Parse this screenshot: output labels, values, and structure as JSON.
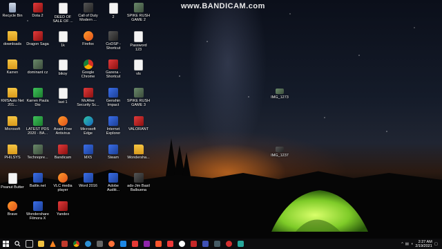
{
  "watermark": "www.BANDICAM.com",
  "desktop_icons": [
    {
      "label": "Recycle Bin",
      "type": "bin"
    },
    {
      "label": "Dota 2",
      "type": "red"
    },
    {
      "label": "DEED OF SALE OF ...",
      "type": "file"
    },
    {
      "label": "Call of Duty Modern ...",
      "type": "dark"
    },
    {
      "label": "2",
      "type": "file"
    },
    {
      "label": "SPIKE RUSH GAME 2",
      "type": "photo"
    },
    {
      "label": "downloads",
      "type": "folder"
    },
    {
      "label": "Dragon Saga",
      "type": "red"
    },
    {
      "label": "1k",
      "type": "file"
    },
    {
      "label": "Firefox",
      "type": "orange"
    },
    {
      "label": "CoDSP - Shortcut",
      "type": "dark"
    },
    {
      "label": "Password 123",
      "type": "file"
    },
    {
      "label": "Karren",
      "type": "folder"
    },
    {
      "label": "dominant cz",
      "type": "photo"
    },
    {
      "label": "bikoy",
      "type": "file"
    },
    {
      "label": "Google Chrome",
      "type": "chrome"
    },
    {
      "label": "Garena - Shortcut",
      "type": "red"
    },
    {
      "label": "vls",
      "type": "file"
    },
    {
      "label": "KMSAuto Net 201...",
      "type": "folder"
    },
    {
      "label": "Karren Paula Dio",
      "type": "green"
    },
    {
      "label": "last 1",
      "type": "file"
    },
    {
      "label": "McAfee Security Sc...",
      "type": "red"
    },
    {
      "label": "Genshin Impact",
      "type": "app"
    },
    {
      "label": "SPIKE RUSH GAME 3",
      "type": "photo"
    },
    {
      "label": "Microsoft",
      "type": "folder"
    },
    {
      "label": "LATEST PDS 2020 - BA...",
      "type": "green"
    },
    {
      "label": "Avast Free Antivirus",
      "type": "orange"
    },
    {
      "label": "Microsoft Edge",
      "type": "edge"
    },
    {
      "label": "Internet Explorer",
      "type": "app"
    },
    {
      "label": "VALORANT",
      "type": "red"
    },
    {
      "label": "PHILSYS",
      "type": "folder"
    },
    {
      "label": "Technopre...",
      "type": "photo"
    },
    {
      "label": "Bandicam",
      "type": "red"
    },
    {
      "label": "MX5",
      "type": "app"
    },
    {
      "label": "Steam",
      "type": "app"
    },
    {
      "label": "Wondersha...",
      "type": "folder"
    },
    {
      "label": "Peanut Butter",
      "type": "file"
    },
    {
      "label": "Battle.net",
      "type": "app"
    },
    {
      "label": "VLC media player",
      "type": "orange"
    },
    {
      "label": "Word 2016",
      "type": "app"
    },
    {
      "label": "Adobe Auditi...",
      "type": "app"
    },
    {
      "label": "ads-Jim Basil Balbuena",
      "type": "dark"
    },
    {
      "label": "Brave",
      "type": "orange"
    },
    {
      "label": "Wondershare Filmora X",
      "type": "app"
    },
    {
      "label": "Yandex",
      "type": "red"
    }
  ],
  "floating_icons": [
    {
      "label": "IMG_1273"
    },
    {
      "label": "IMG_1237"
    }
  ],
  "taskbar": {
    "start_icon": "windows-icon",
    "search_icon": "search-icon",
    "clock_time": "2:27 AM",
    "clock_date": "2/19/2021"
  }
}
